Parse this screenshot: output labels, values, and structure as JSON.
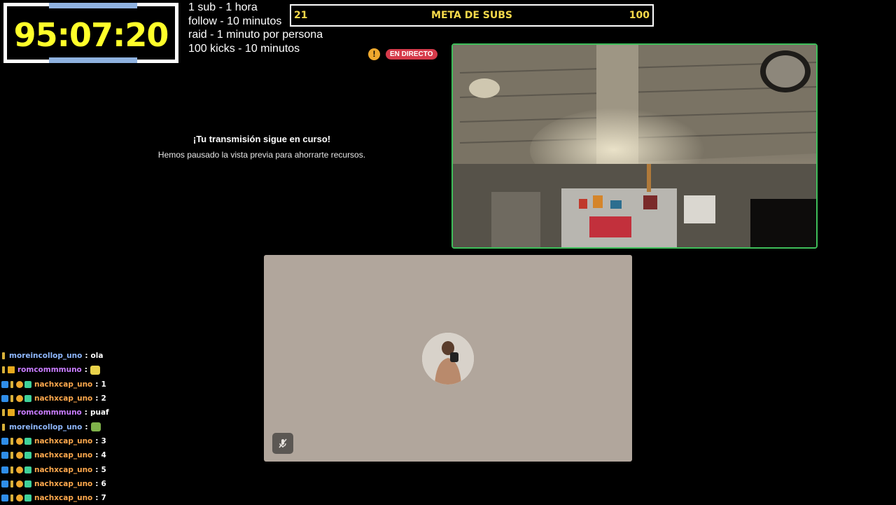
{
  "timer": {
    "display": "95:07:20"
  },
  "rules": [
    "1 sub - 1 hora",
    "follow - 10 minutos",
    "raid - 1 minuto por persona",
    "100 kicks - 10 minutos"
  ],
  "sub_goal": {
    "current": "21",
    "title": "META DE SUBS",
    "target": "100",
    "accent_color": "#f5d94a"
  },
  "stream_status": {
    "warning_glyph": "!",
    "live_label": "EN DIRECTO",
    "live_color": "#d63a4a"
  },
  "preview": {
    "title": "¡Tu transmisión sigue en curso!",
    "subtitle": "Hemos pausado la vista previa para ahorrarte recursos."
  },
  "camera": {
    "border_color": "#3ebe5a"
  },
  "call": {
    "panel_color": "#b1a69c",
    "mute_icon": "mic-muted-icon"
  },
  "chat": [
    {
      "badges": [
        "verified"
      ],
      "user": "moreincollop_uno",
      "color": "#8fb8ff",
      "text": "ola"
    },
    {
      "badges": [
        "verified",
        "crown"
      ],
      "user": "romcommmuno",
      "color": "#c87cff",
      "text": "",
      "emote": "emote-yellow"
    },
    {
      "badges": [
        "mod",
        "verified",
        "gold",
        "green"
      ],
      "user": "nachxcap_uno",
      "color": "#ffa94d",
      "text": "1"
    },
    {
      "badges": [
        "mod",
        "verified",
        "gold",
        "green"
      ],
      "user": "nachxcap_uno",
      "color": "#ffa94d",
      "text": "2"
    },
    {
      "badges": [
        "verified",
        "crown"
      ],
      "user": "romcommmuno",
      "color": "#c87cff",
      "text": "puaf"
    },
    {
      "badges": [
        "verified"
      ],
      "user": "moreincollop_uno",
      "color": "#8fb8ff",
      "text": "",
      "emote": "emote-green"
    },
    {
      "badges": [
        "mod",
        "verified",
        "gold",
        "green"
      ],
      "user": "nachxcap_uno",
      "color": "#ffa94d",
      "text": "3"
    },
    {
      "badges": [
        "mod",
        "verified",
        "gold",
        "green"
      ],
      "user": "nachxcap_uno",
      "color": "#ffa94d",
      "text": "4"
    },
    {
      "badges": [
        "mod",
        "verified",
        "gold",
        "green"
      ],
      "user": "nachxcap_uno",
      "color": "#ffa94d",
      "text": "5"
    },
    {
      "badges": [
        "mod",
        "verified",
        "gold",
        "green"
      ],
      "user": "nachxcap_uno",
      "color": "#ffa94d",
      "text": "6"
    },
    {
      "badges": [
        "mod",
        "verified",
        "gold",
        "green"
      ],
      "user": "nachxcap_uno",
      "color": "#ffa94d",
      "text": "7"
    }
  ]
}
